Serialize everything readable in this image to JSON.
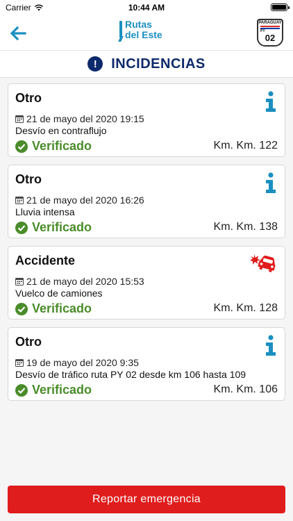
{
  "status_bar": {
    "carrier": "Carrier",
    "time": "10:44 AM"
  },
  "header": {
    "logo_line1": "Rutas",
    "logo_line2": "del Este",
    "plate_country": "PARAGUAY",
    "plate_code": "PY",
    "plate_number": "02",
    "brand_color": "#1a8fc0"
  },
  "section": {
    "icon": "exclamation-circle-icon",
    "title": "INCIDENCIAS"
  },
  "incidents": [
    {
      "type": "Otro",
      "icon": "info-icon",
      "date": "21 de mayo del 2020 19:15",
      "description": "Desvío en contraflujo",
      "status": "Verificado",
      "km": "Km. Km. 122"
    },
    {
      "type": "Otro",
      "icon": "info-icon",
      "date": "21 de mayo del 2020 16:26",
      "description": "Lluvia intensa",
      "status": "Verificado",
      "km": "Km. Km. 138"
    },
    {
      "type": "Accidente",
      "icon": "car-crash-icon",
      "date": "21 de mayo del 2020 15:53",
      "description": "Vuelco de camiones",
      "status": "Verificado",
      "km": "Km. Km. 128"
    },
    {
      "type": "Otro",
      "icon": "info-icon",
      "date": "19 de mayo del 2020 9:35",
      "description": "Desvío de tráfico ruta PY 02 desde km 106 hasta 109",
      "status": "Verificado",
      "km": "Km. Km. 106"
    }
  ],
  "footer": {
    "report_button_label": "Reportar emergencia",
    "report_button_color": "#e01d1d"
  },
  "colors": {
    "verified_green": "#4a8c2a",
    "info_blue": "#1a8fc0",
    "title_navy": "#0d2a6b",
    "accident_red": "#e01d1d"
  }
}
